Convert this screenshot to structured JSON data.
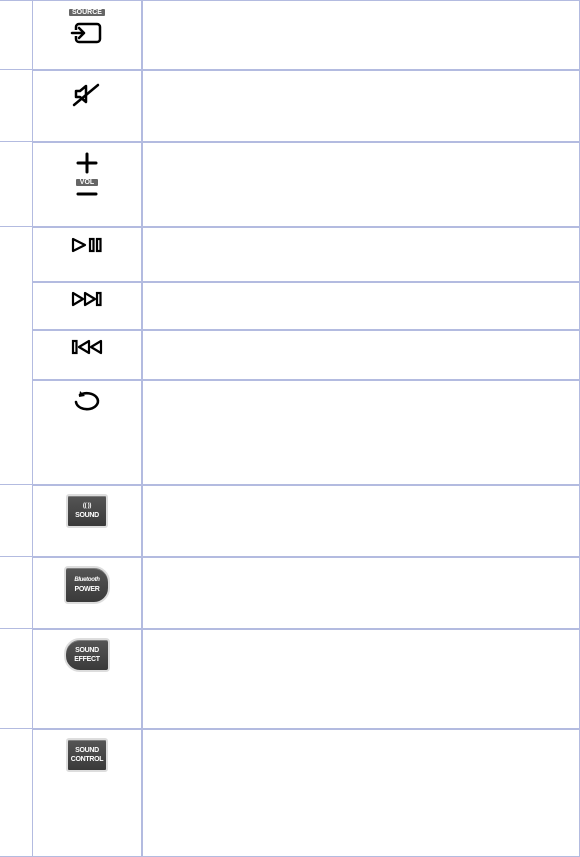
{
  "rows": {
    "source_label": "SOURCE",
    "vol_label": "VOL",
    "sound_line1": "(( ))",
    "sound_line2": "SOUND",
    "bt_line1": "Bluetooth",
    "bt_line2": "POWER",
    "se_line1": "SOUND",
    "se_line2": "EFFECT",
    "sc_line1": "SOUND",
    "sc_line2": "CONTROL"
  },
  "row_heights": {
    "source": 70,
    "mute": 72,
    "vol": 85,
    "playpause": 55,
    "next": 48,
    "prev": 50,
    "repeat": 105,
    "sound": 72,
    "bt": 72,
    "effect": 100,
    "control": 128
  }
}
